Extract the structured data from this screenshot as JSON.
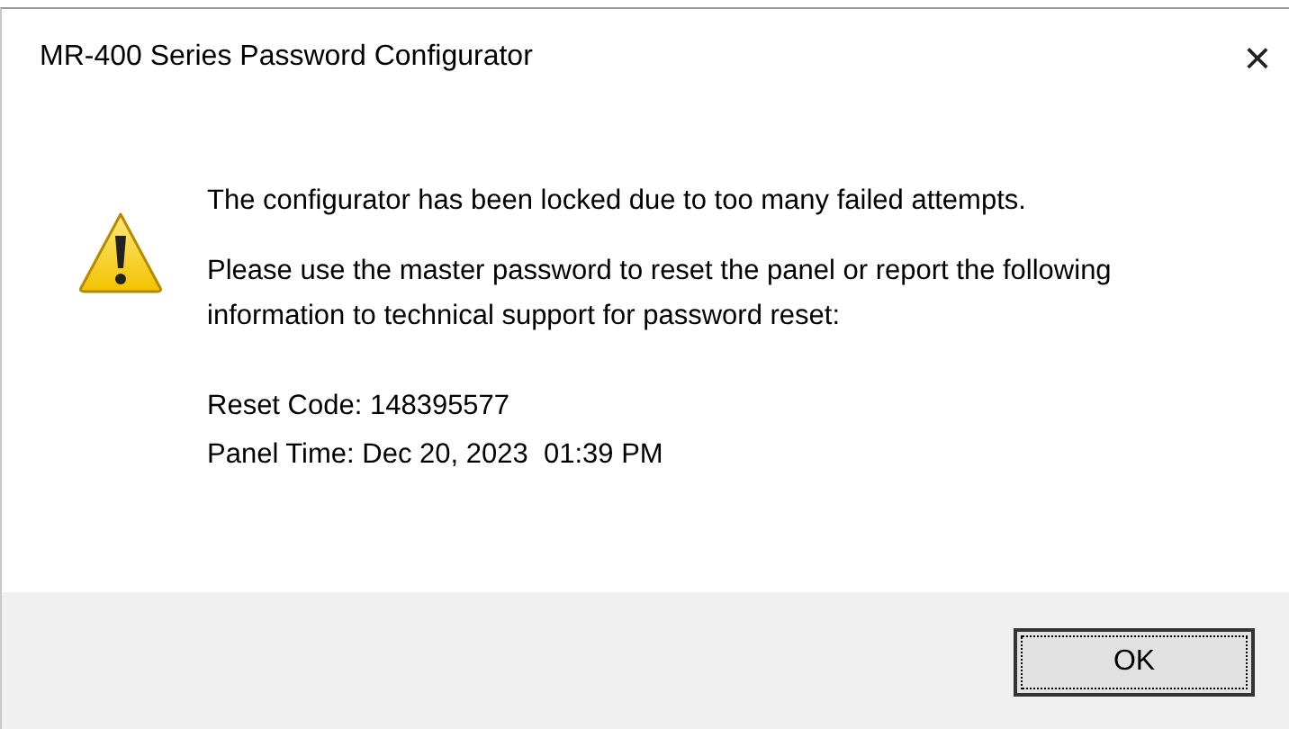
{
  "window": {
    "title": "MR-400 Series Password Configurator",
    "close": "×"
  },
  "message": {
    "lines": [
      "The configurator has been locked due to too many failed attempts.",
      "Please use the master password to reset the panel or report the following information to technical support for password reset:"
    ],
    "details": [
      "Reset Code: 148395577",
      "Panel Time: Dec 20, 2023  01:39 PM"
    ]
  },
  "buttons": [
    {
      "label": "OK",
      "selected": true
    }
  ]
}
